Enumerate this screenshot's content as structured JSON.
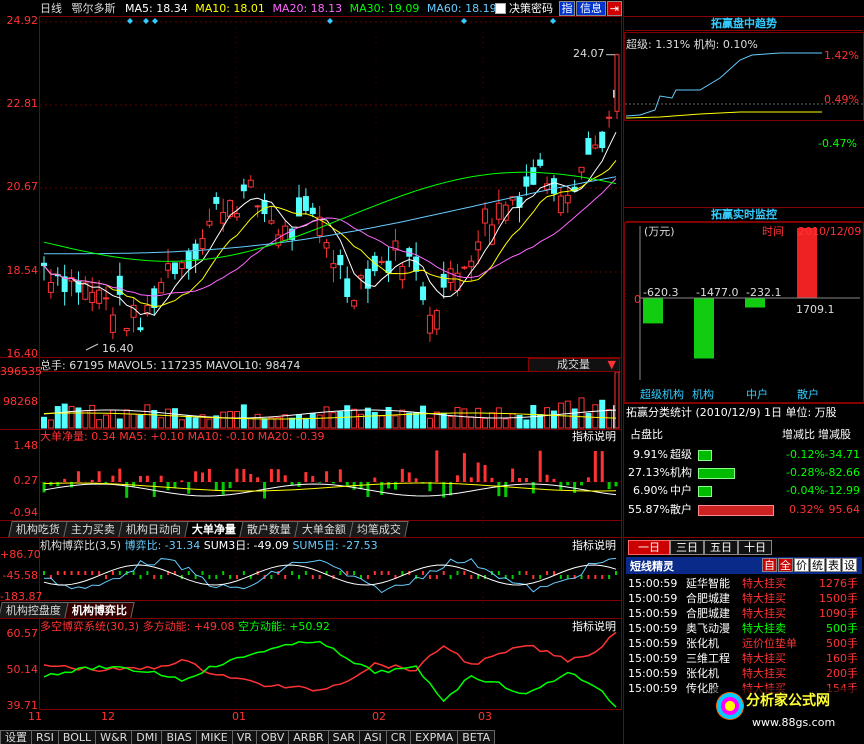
{
  "header": {
    "period": "日线",
    "stock": "鄂尔多斯",
    "ma": [
      {
        "label": "MA5: 18.34",
        "color": "#ffffff"
      },
      {
        "label": "MA10: 18.01",
        "color": "#ffff00"
      },
      {
        "label": "MA20: 18.13",
        "color": "#ff66ff"
      },
      {
        "label": "MA30: 19.09",
        "color": "#00ff00"
      },
      {
        "label": "MA60: 18.19",
        "color": "#66ccff"
      }
    ],
    "checkbox_label": "决策密码",
    "btn_zhi": "指",
    "btn_info": "信息"
  },
  "price_axis": [
    "24.92",
    "22.81",
    "20.67",
    "18.54",
    "16.40"
  ],
  "price_notes": {
    "high": "24.07",
    "low": "16.40"
  },
  "volume": {
    "info": "总手: 67195  MAVOL5: 117235  MAVOL10: 98474",
    "dropdown": "成交量",
    "axis": [
      "396535",
      "98268"
    ]
  },
  "bignet": {
    "title": "大单净量",
    "line": "大单净量: 0.34  MA5: +0.10  MA10: -0.10  MA20: -0.39",
    "axis": [
      "1.48",
      "0.27",
      "-0.94"
    ],
    "help": "指标说明"
  },
  "tabs1": [
    "机构吃货",
    "主力买卖",
    "机构日动向",
    "大单净量",
    "散户数量",
    "大单金额",
    "均笔成交"
  ],
  "game": {
    "line1": "机构博弈比(3,5)",
    "line2": "博弈比: -31.34",
    "line3": "SUM3日: -49.09",
    "line4": "SUM5日: -27.53",
    "axis": [
      "+86.70",
      "-45.58",
      "-183.87"
    ],
    "help": "指标说明"
  },
  "tabs2": [
    "机构控盘度",
    "机构博弈比"
  ],
  "dk": {
    "line1": "多空博弈系统(30,3)",
    "line2": "多方动能: +49.08",
    "line3": "空方动能: +50.92",
    "axis": [
      "60.57",
      "50.14",
      "39.71"
    ],
    "help": "指标说明"
  },
  "xaxis": [
    "11",
    "12",
    "01",
    "02",
    "03"
  ],
  "bottom_tabs": [
    "设置",
    "RSI",
    "BOLL",
    "W&R",
    "DMI",
    "BIAS",
    "MIKE",
    "VR",
    "OBV",
    "ARBR",
    "SAR",
    "ASI",
    "CR",
    "EXPMA",
    "BETA"
  ],
  "right": {
    "trend_title": "拓赢盘中趋势",
    "trend_legend": "超级: 1.31%  机构: 0.10%",
    "trend_axis": [
      "1.42%",
      "0.49%",
      "-0.47%"
    ],
    "monitor_title": "拓赢实时监控",
    "monitor_unit": "(万元)",
    "monitor_time_label": "时间",
    "monitor_date": "2010/12/09",
    "monitor_values": [
      "-620.3",
      "-1477.0",
      "-232.1",
      "1709.1"
    ],
    "monitor_labels": [
      "超级机构",
      "机构",
      "中户",
      "散户"
    ],
    "monitor_zero": "0",
    "stats_header": "拓赢分类统计 (2010/12/9) 1日 单位: 万股",
    "stats_cols": [
      "占盘比",
      "增减比",
      "增减股"
    ],
    "stats_rows": [
      {
        "pct": "9.91%",
        "name": "超级",
        "ratio": "-0.12%",
        "amt": "-34.71",
        "fill": 0.18
      },
      {
        "pct": "27.13%",
        "name": "机构",
        "ratio": "-0.28%",
        "amt": "-82.66",
        "fill": 0.49
      },
      {
        "pct": "6.90%",
        "name": "中户",
        "ratio": "-0.04%",
        "amt": "-12.99",
        "fill": 0.12
      },
      {
        "pct": "55.87%",
        "name": "散户",
        "ratio": "0.32%",
        "amt": "95.64",
        "fill": 1.0
      }
    ],
    "period_tabs": [
      "一日",
      "三日",
      "五日",
      "十日"
    ],
    "short_title": "短线精灵",
    "short_btns": [
      "自",
      "全",
      "价",
      "统",
      "表",
      "设"
    ],
    "short_rows": [
      {
        "t": "15:00:59",
        "n": "延华智能",
        "e": "特大挂买",
        "v": "1276手",
        "c": "#ff3333"
      },
      {
        "t": "15:00:59",
        "n": "合肥城建",
        "e": "特大挂买",
        "v": "1500手",
        "c": "#ff3333"
      },
      {
        "t": "15:00:59",
        "n": "合肥城建",
        "e": "特大挂买",
        "v": "1090手",
        "c": "#ff3333"
      },
      {
        "t": "15:00:59",
        "n": "奥飞动漫",
        "e": "特大挂卖",
        "v": "500手",
        "c": "#00ff00"
      },
      {
        "t": "15:00:59",
        "n": "张化机",
        "e": "远价位垫单",
        "v": "500手",
        "c": "#ff3333"
      },
      {
        "t": "15:00:59",
        "n": "三维工程",
        "e": "特大挂买",
        "v": "160手",
        "c": "#ff3333"
      },
      {
        "t": "15:00:59",
        "n": "张化机",
        "e": "特大挂买",
        "v": "200手",
        "c": "#ff3333"
      },
      {
        "t": "15:00:59",
        "n": "传化股",
        "e": "特大挂买",
        "v": "154手",
        "c": "#ff3333"
      }
    ],
    "watermark": "分析家公式网",
    "watermark_url": "www.88gs.com"
  },
  "colors": {
    "up": "#ff3333",
    "down": "#54ffff",
    "grid": "#800000"
  }
}
